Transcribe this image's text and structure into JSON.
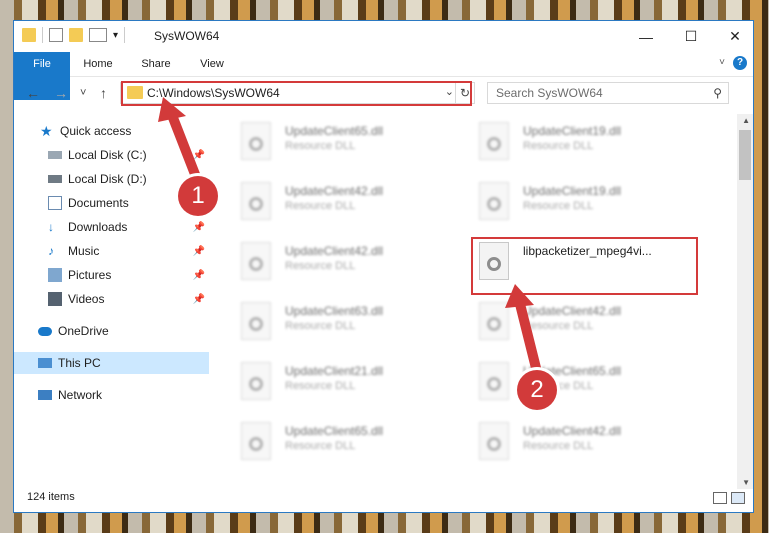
{
  "window": {
    "title": "SysWOW64",
    "controls": {
      "minimize": "—",
      "maximize": "☐",
      "close": "✕"
    }
  },
  "ribbon": {
    "tabs": [
      "File",
      "Home",
      "Share",
      "View"
    ],
    "help": "?"
  },
  "navigation": {
    "back": "←",
    "forward": "→",
    "recent": "˅",
    "up": "↑",
    "address": "C:\\Windows\\SysWOW64",
    "search_placeholder": "Search SysWOW64"
  },
  "sidebar": {
    "items": [
      {
        "label": "Quick access",
        "icon": "star-icon"
      },
      {
        "label": "Local Disk (C:)",
        "icon": "drive-icon",
        "pinned": true
      },
      {
        "label": "Local Disk (D:)",
        "icon": "drive-icon",
        "pinned": false
      },
      {
        "label": "Documents",
        "icon": "documents-icon",
        "pinned": true
      },
      {
        "label": "Downloads",
        "icon": "download-icon",
        "pinned": true
      },
      {
        "label": "Music",
        "icon": "music-icon",
        "pinned": true
      },
      {
        "label": "Pictures",
        "icon": "pictures-icon",
        "pinned": true
      },
      {
        "label": "Videos",
        "icon": "videos-icon",
        "pinned": true
      },
      {
        "label": "OneDrive",
        "icon": "cloud-icon"
      },
      {
        "label": "This PC",
        "icon": "computer-icon",
        "selected": true
      },
      {
        "label": "Network",
        "icon": "network-icon"
      }
    ]
  },
  "files": [
    {
      "name": "UpdateClient65.dll",
      "type": "Resource DLL"
    },
    {
      "name": "UpdateClient19.dll",
      "type": "Resource DLL"
    },
    {
      "name": "UpdateClient42.dll",
      "type": "Resource DLL"
    },
    {
      "name": "UpdateClient19.dll",
      "type": "Resource DLL"
    },
    {
      "name": "UpdateClient42.dll",
      "type": "Resource DLL"
    },
    {
      "name": "libpacketizer_mpeg4vi...",
      "type": ""
    },
    {
      "name": "UpdateClient63.dll",
      "type": "Resource DLL"
    },
    {
      "name": "UpdateClient42.dll",
      "type": "Resource DLL"
    },
    {
      "name": "UpdateClient21.dll",
      "type": "Resource DLL"
    },
    {
      "name": "UpdateClient65.dll",
      "type": "Resource DLL"
    },
    {
      "name": "UpdateClient65.dll",
      "type": "Resource DLL"
    },
    {
      "name": "UpdateClient42.dll",
      "type": "Resource DLL"
    }
  ],
  "status": {
    "items_count": "124 items"
  },
  "callouts": [
    "1",
    "2"
  ],
  "colors": {
    "accent": "#1979ca",
    "highlight": "#d43a3a",
    "selected": "#cce8ff"
  }
}
